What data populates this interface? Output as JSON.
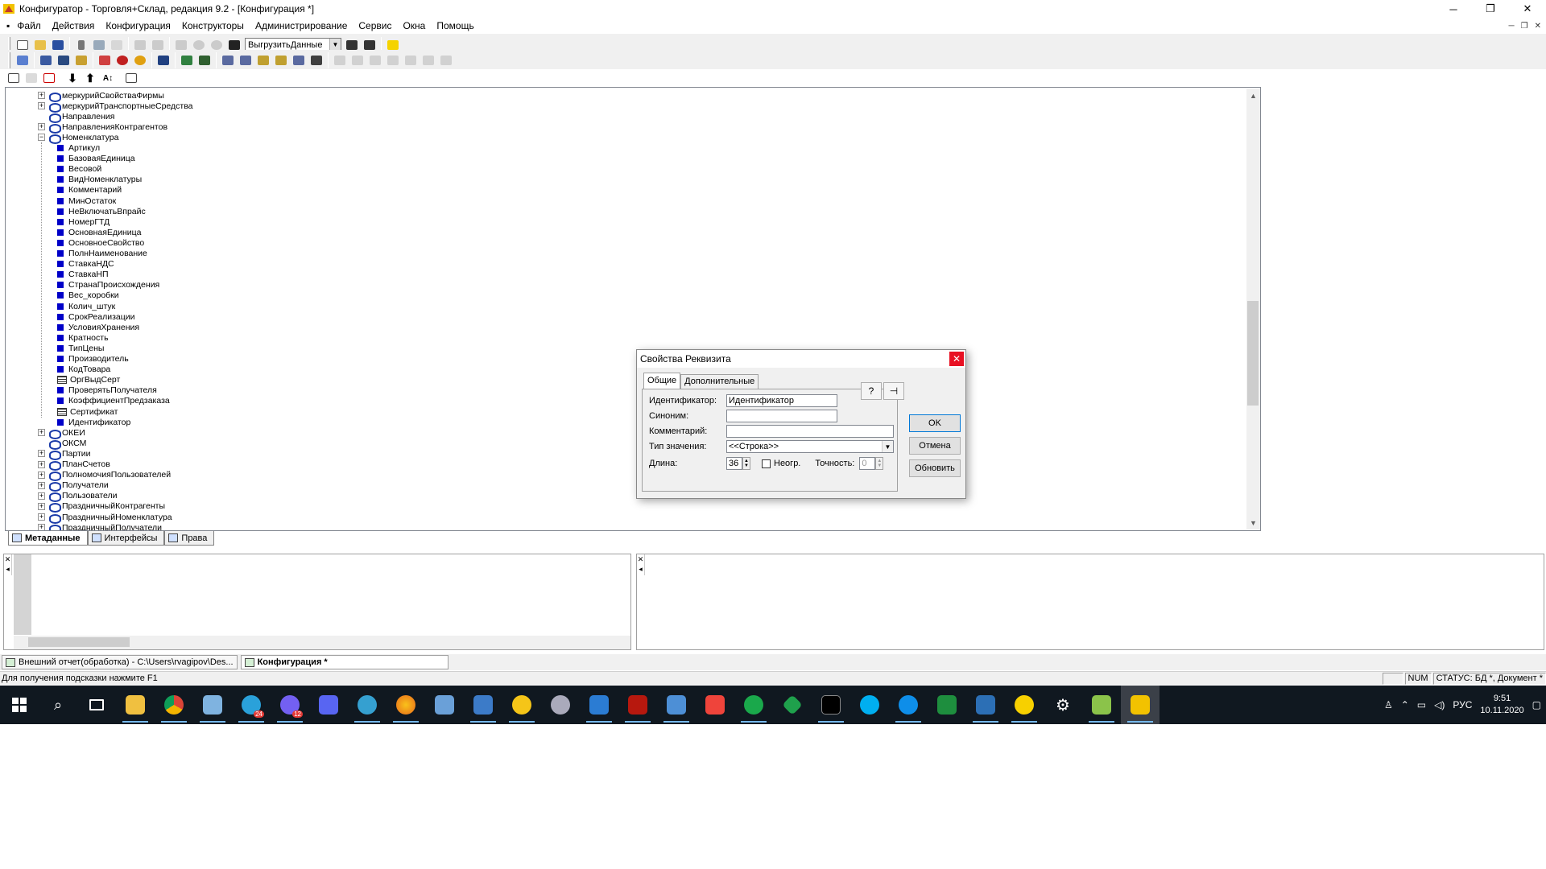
{
  "window": {
    "title": "Конфигуратор - Торговля+Склад, редакция 9.2 - [Конфигурация *]",
    "min": "─",
    "restore": "❐",
    "close": "✕"
  },
  "menu": {
    "items": [
      "Файл",
      "Действия",
      "Конфигурация",
      "Конструкторы",
      "Администрирование",
      "Сервис",
      "Окна",
      "Помощь"
    ],
    "mdi": [
      "─",
      "❐",
      "✕"
    ]
  },
  "toolbar": {
    "combo_value": "ВыгрузитьДанные"
  },
  "tree": {
    "rows": [
      {
        "label": "меркурийСвойстваФирмы",
        "lvl": 0,
        "exp": "+",
        "icon": "obj"
      },
      {
        "label": "меркурийТранспортныеСредства",
        "lvl": 0,
        "exp": "+",
        "icon": "obj"
      },
      {
        "label": "Направления",
        "lvl": 0,
        "exp": "",
        "icon": "obj"
      },
      {
        "label": "НаправленияКонтрагентов",
        "lvl": 0,
        "exp": "+",
        "icon": "obj"
      },
      {
        "label": "Номенклатура",
        "lvl": 0,
        "exp": "−",
        "icon": "obj"
      },
      {
        "label": "Артикул",
        "lvl": 1,
        "icon": "attr"
      },
      {
        "label": "БазоваяЕдиница",
        "lvl": 1,
        "icon": "attr"
      },
      {
        "label": "Весовой",
        "lvl": 1,
        "icon": "attr"
      },
      {
        "label": "ВидНоменклатуры",
        "lvl": 1,
        "icon": "attr"
      },
      {
        "label": "Комментарий",
        "lvl": 1,
        "icon": "attr"
      },
      {
        "label": "МинОстаток",
        "lvl": 1,
        "icon": "attr"
      },
      {
        "label": "НеВключатьВпрайс",
        "lvl": 1,
        "icon": "attr"
      },
      {
        "label": "НомерГТД",
        "lvl": 1,
        "icon": "attr"
      },
      {
        "label": "ОсновнаяЕдиница",
        "lvl": 1,
        "icon": "attr"
      },
      {
        "label": "ОсновноеСвойство",
        "lvl": 1,
        "icon": "attr"
      },
      {
        "label": "ПолнНаименование",
        "lvl": 1,
        "icon": "attr"
      },
      {
        "label": "СтавкаНДС",
        "lvl": 1,
        "icon": "attr"
      },
      {
        "label": "СтавкаНП",
        "lvl": 1,
        "icon": "attr"
      },
      {
        "label": "СтранаПроисхождения",
        "lvl": 1,
        "icon": "attr"
      },
      {
        "label": "Вес_коробки",
        "lvl": 1,
        "icon": "attr"
      },
      {
        "label": "Колич_штук",
        "lvl": 1,
        "icon": "attr"
      },
      {
        "label": "СрокРеализации",
        "lvl": 1,
        "icon": "attr"
      },
      {
        "label": "УсловияХранения",
        "lvl": 1,
        "icon": "attr"
      },
      {
        "label": "Кратность",
        "lvl": 1,
        "icon": "attr"
      },
      {
        "label": "ТипЦены",
        "lvl": 1,
        "icon": "attr"
      },
      {
        "label": "Производитель",
        "lvl": 1,
        "icon": "attr"
      },
      {
        "label": "КодТовара",
        "lvl": 1,
        "icon": "attr"
      },
      {
        "label": "ОргВыдСерт",
        "lvl": 1,
        "icon": "tbl"
      },
      {
        "label": "ПроверятьПолучателя",
        "lvl": 1,
        "icon": "attr"
      },
      {
        "label": "КоэффициентПредзаказа",
        "lvl": 1,
        "icon": "attr"
      },
      {
        "label": "Сертификат",
        "lvl": 1,
        "icon": "tbl"
      },
      {
        "label": "Идентификатор",
        "lvl": 1,
        "icon": "attr"
      },
      {
        "label": "ОКЕИ",
        "lvl": 0,
        "exp": "+",
        "icon": "obj"
      },
      {
        "label": "ОКСМ",
        "lvl": 0,
        "exp": "",
        "icon": "obj"
      },
      {
        "label": "Партии",
        "lvl": 0,
        "exp": "+",
        "icon": "obj"
      },
      {
        "label": "ПланСчетов",
        "lvl": 0,
        "exp": "+",
        "icon": "obj"
      },
      {
        "label": "ПолномочияПользователей",
        "lvl": 0,
        "exp": "+",
        "icon": "obj"
      },
      {
        "label": "Получатели",
        "lvl": 0,
        "exp": "+",
        "icon": "obj"
      },
      {
        "label": "Пользователи",
        "lvl": 0,
        "exp": "+",
        "icon": "obj"
      },
      {
        "label": "ПраздничныйКонтрагенты",
        "lvl": 0,
        "exp": "+",
        "icon": "obj"
      },
      {
        "label": "ПраздничныйНоменклатура",
        "lvl": 0,
        "exp": "+",
        "icon": "obj"
      },
      {
        "label": "ПраздничныйПолучатели",
        "lvl": 0,
        "exp": "+",
        "icon": "obj"
      }
    ]
  },
  "bottom_tabs": [
    {
      "label": "Метаданные",
      "active": true
    },
    {
      "label": "Интерфейсы"
    },
    {
      "label": "Права"
    }
  ],
  "window_tabs": [
    {
      "label": "Внешний отчет(обработка) - C:\\Users\\rvagipov\\Des..."
    },
    {
      "label": "Конфигурация *",
      "active": true
    }
  ],
  "status": {
    "hint": "Для получения подсказки нажмите F1",
    "num": "NUM",
    "db": "СТАТУС: БД *, Документ *"
  },
  "dialog": {
    "title": "Свойства Реквизита",
    "tabs": [
      "Общие",
      "Дополнительные"
    ],
    "fields": {
      "id_label": "Идентификатор:",
      "id_value": "Идентификатор",
      "syn_label": "Синоним:",
      "syn_value": "",
      "comment_label": "Комментарий:",
      "comment_value": "",
      "type_label": "Тип значения:",
      "type_value": "<<Строка>>",
      "len_label": "Длина:",
      "len_value": "36",
      "unlim_label": "Неогр.",
      "prec_label": "Точность:",
      "prec_value": "0"
    },
    "buttons": {
      "ok": "OK",
      "cancel": "Отмена",
      "update": "Обновить",
      "help": "?",
      "pin": "⊣"
    }
  },
  "taskbar": {
    "lang": "РУС",
    "time": "9:51",
    "date": "10.11.2020",
    "badges": {
      "telegram": "24",
      "viber": "12"
    }
  }
}
